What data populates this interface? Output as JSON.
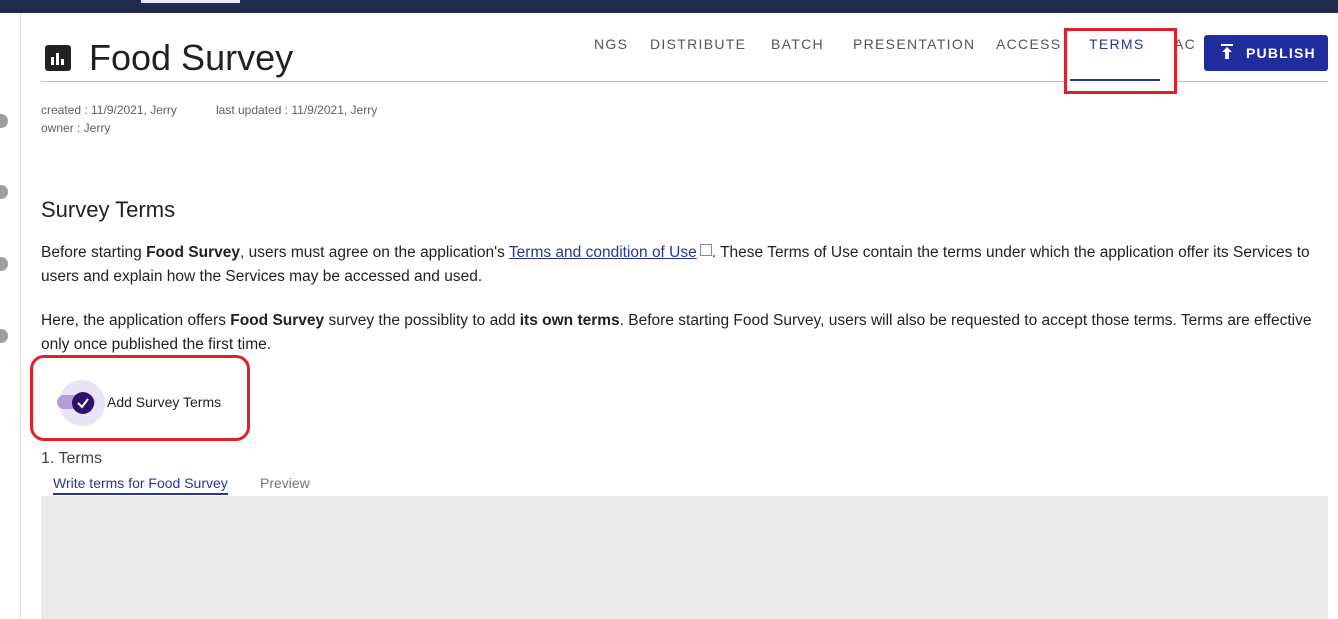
{
  "app": {
    "title": "Food Survey"
  },
  "nav": {
    "tabs": [
      {
        "label": "NGS"
      },
      {
        "label": "DISTRIBUTE"
      },
      {
        "label": "BATCH"
      },
      {
        "label": "PRESENTATION"
      },
      {
        "label": "ACCESS"
      },
      {
        "label": "TERMS",
        "active": true
      },
      {
        "label": "AC"
      }
    ],
    "publish_label": "PUBLISH"
  },
  "meta": {
    "created": "created : 11/9/2021, Jerry",
    "updated": "last updated : 11/9/2021, Jerry",
    "owner": "owner : Jerry"
  },
  "section": {
    "title": "Survey Terms",
    "p1_a": "Before starting ",
    "p1_bold": "Food Survey",
    "p1_b": ", users must agree on the application's ",
    "p1_link": "Terms and condition of Use",
    "p1_c": ". These Terms of Use contain the terms under which the application offer its Services to users and explain how the Services may be accessed and used.",
    "p2_a": "Here, the application offers ",
    "p2_bold1": "Food Survey",
    "p2_b": " survey the possiblity to add ",
    "p2_bold2": "its own terms",
    "p2_c": ". Before starting Food Survey, users will also be requested to accept those terms. Terms are effective only once published the first time."
  },
  "toggle": {
    "label": "Add Survey Terms",
    "checked": true
  },
  "terms": {
    "heading": "1. Terms",
    "tabs": [
      {
        "label": "Write terms for Food Survey",
        "active": true
      },
      {
        "label": "Preview"
      }
    ]
  },
  "colors": {
    "accent": "#283593",
    "publish": "#1f2d9f",
    "highlight": "#e0202a",
    "topbar": "#1f2a4d"
  }
}
